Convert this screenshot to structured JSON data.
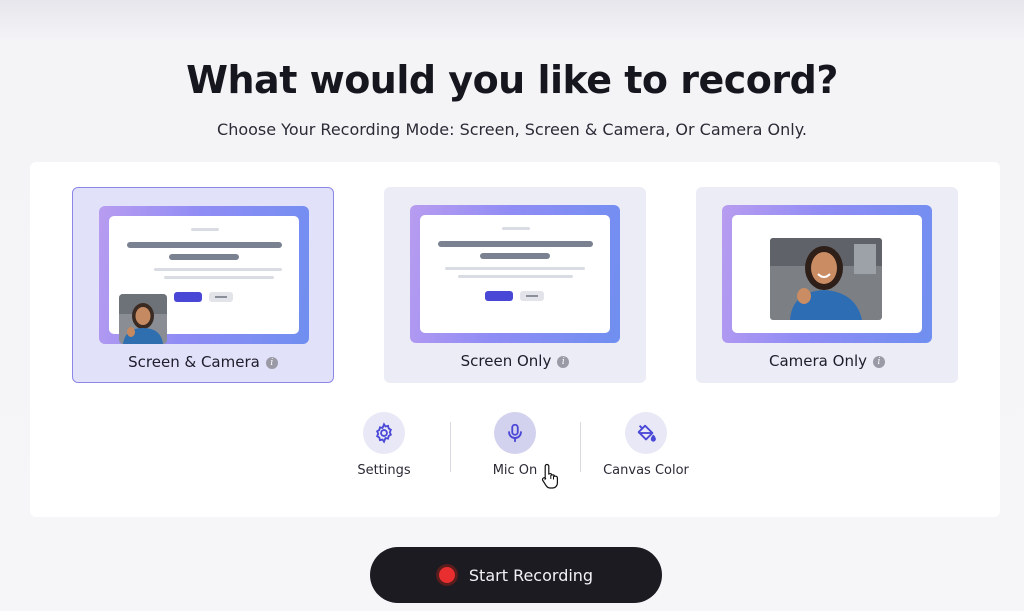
{
  "header": {
    "title": "What would you like to record?",
    "subtitle": "Choose Your Recording Mode: Screen, Screen & Camera, Or Camera Only."
  },
  "modes": [
    {
      "label": "Screen & Camera",
      "selected": true,
      "info_icon": "info-icon"
    },
    {
      "label": "Screen Only",
      "selected": false,
      "info_icon": "info-icon"
    },
    {
      "label": "Camera Only",
      "selected": false,
      "info_icon": "info-icon"
    }
  ],
  "toolbar": {
    "settings_label": "Settings",
    "settings_icon": "gear-icon",
    "mic_label": "Mic On",
    "mic_icon": "microphone-icon",
    "canvas_label": "Canvas Color",
    "canvas_icon": "paint-bucket-icon"
  },
  "start": {
    "label": "Start Recording",
    "icon": "record-dot-icon"
  },
  "colors": {
    "accent": "#4847d6",
    "selected_card": "#e2e1fa",
    "record_red": "#e82e2e",
    "start_bg": "#1c1b22"
  }
}
